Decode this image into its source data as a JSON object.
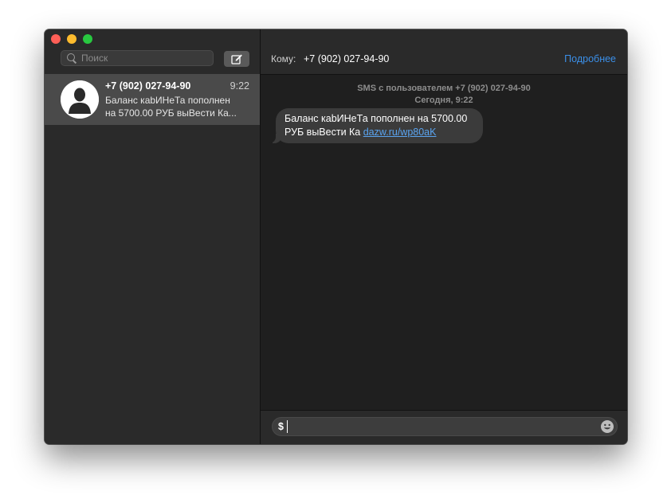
{
  "sidebar": {
    "search": {
      "placeholder": "Поиск"
    },
    "conversations": [
      {
        "name": "+7 (902) 027-94-90",
        "time": "9:22",
        "preview_line1": "Баланс каbИНеТа пополнен",
        "preview_line2": "на 5700.00 РУБ выВести Ка..."
      }
    ]
  },
  "header": {
    "to_label": "Кому:",
    "to_value": "+7 (902) 027-94-90",
    "details_label": "Подробнее"
  },
  "thread": {
    "info_line1": "SMS с пользователем +7 (902) 027-94-90",
    "info_line2": "Сегодня, 9:22",
    "messages": [
      {
        "text": "Баланс каbИНеТа пополнен на 5700.00 РУБ выВести Ка ",
        "link": "dazw.ru/wp80aK"
      }
    ]
  },
  "composer": {
    "value": "$"
  },
  "icons": {
    "search": "search-icon",
    "compose": "compose-icon",
    "avatar": "person-silhouette-icon",
    "emoji": "emoji-icon"
  },
  "colors": {
    "close": "#ff5f57",
    "minimize": "#febc2e",
    "maximize": "#28c840",
    "link": "#3b8fe8"
  }
}
